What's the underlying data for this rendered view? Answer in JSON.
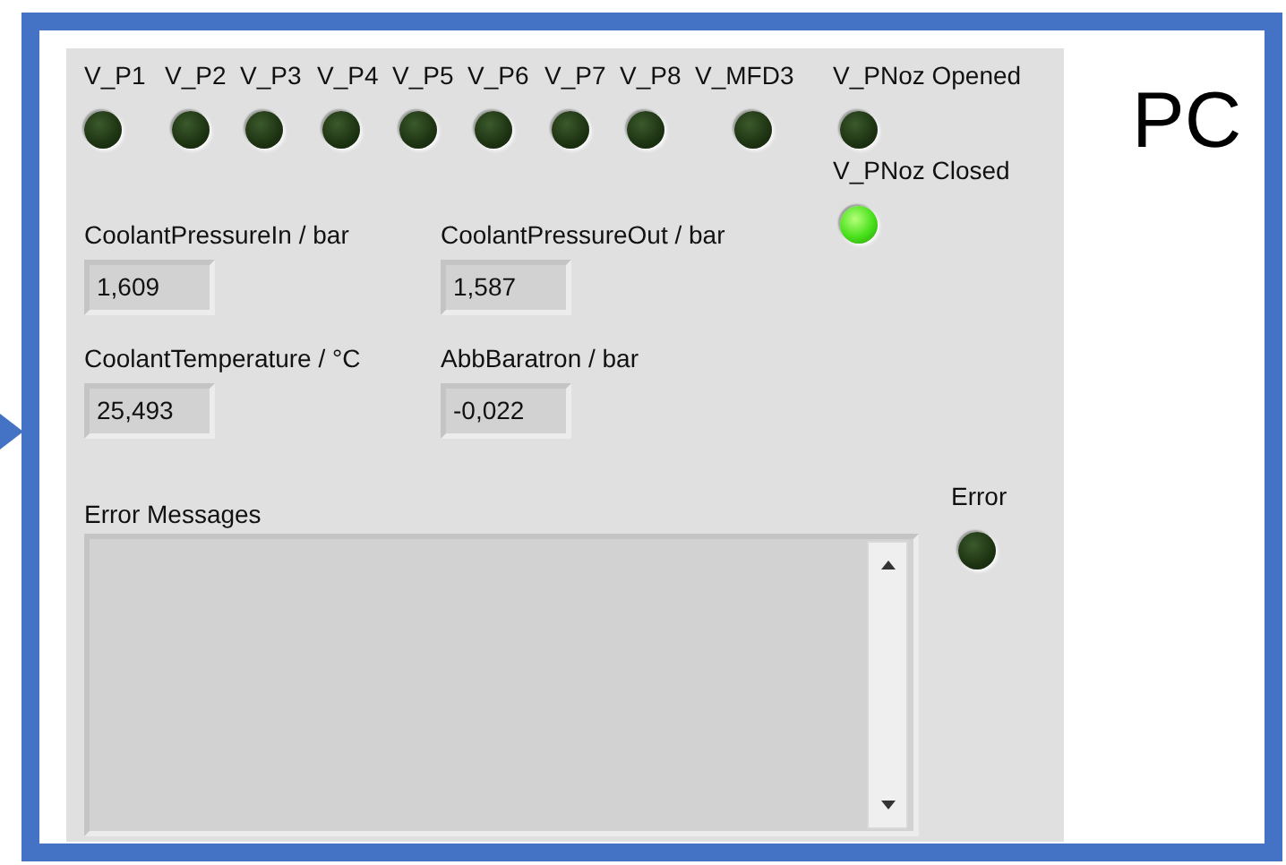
{
  "slide_label": "PC",
  "leds": [
    {
      "label": "V_P1",
      "on": false
    },
    {
      "label": "V_P2",
      "on": false
    },
    {
      "label": "V_P3",
      "on": false
    },
    {
      "label": "V_P4",
      "on": false
    },
    {
      "label": "V_P5",
      "on": false
    },
    {
      "label": "V_P6",
      "on": false
    },
    {
      "label": "V_P7",
      "on": false
    },
    {
      "label": "V_P8",
      "on": false
    },
    {
      "label": "V_MFD3",
      "on": false
    },
    {
      "label": "V_PNoz Opened",
      "on": false
    },
    {
      "label": "V_PNoz Closed",
      "on": true
    },
    {
      "label": "Error",
      "on": false
    }
  ],
  "numerics": [
    {
      "label": "CoolantPressureIn / bar",
      "value": "1,609"
    },
    {
      "label": "CoolantPressureOut / bar",
      "value": "1,587"
    },
    {
      "label": "CoolantTemperature / °C",
      "value": "25,493"
    },
    {
      "label": "AbbBaratron / bar",
      "value": "-0,022"
    }
  ],
  "error_messages": {
    "label": "Error Messages"
  }
}
